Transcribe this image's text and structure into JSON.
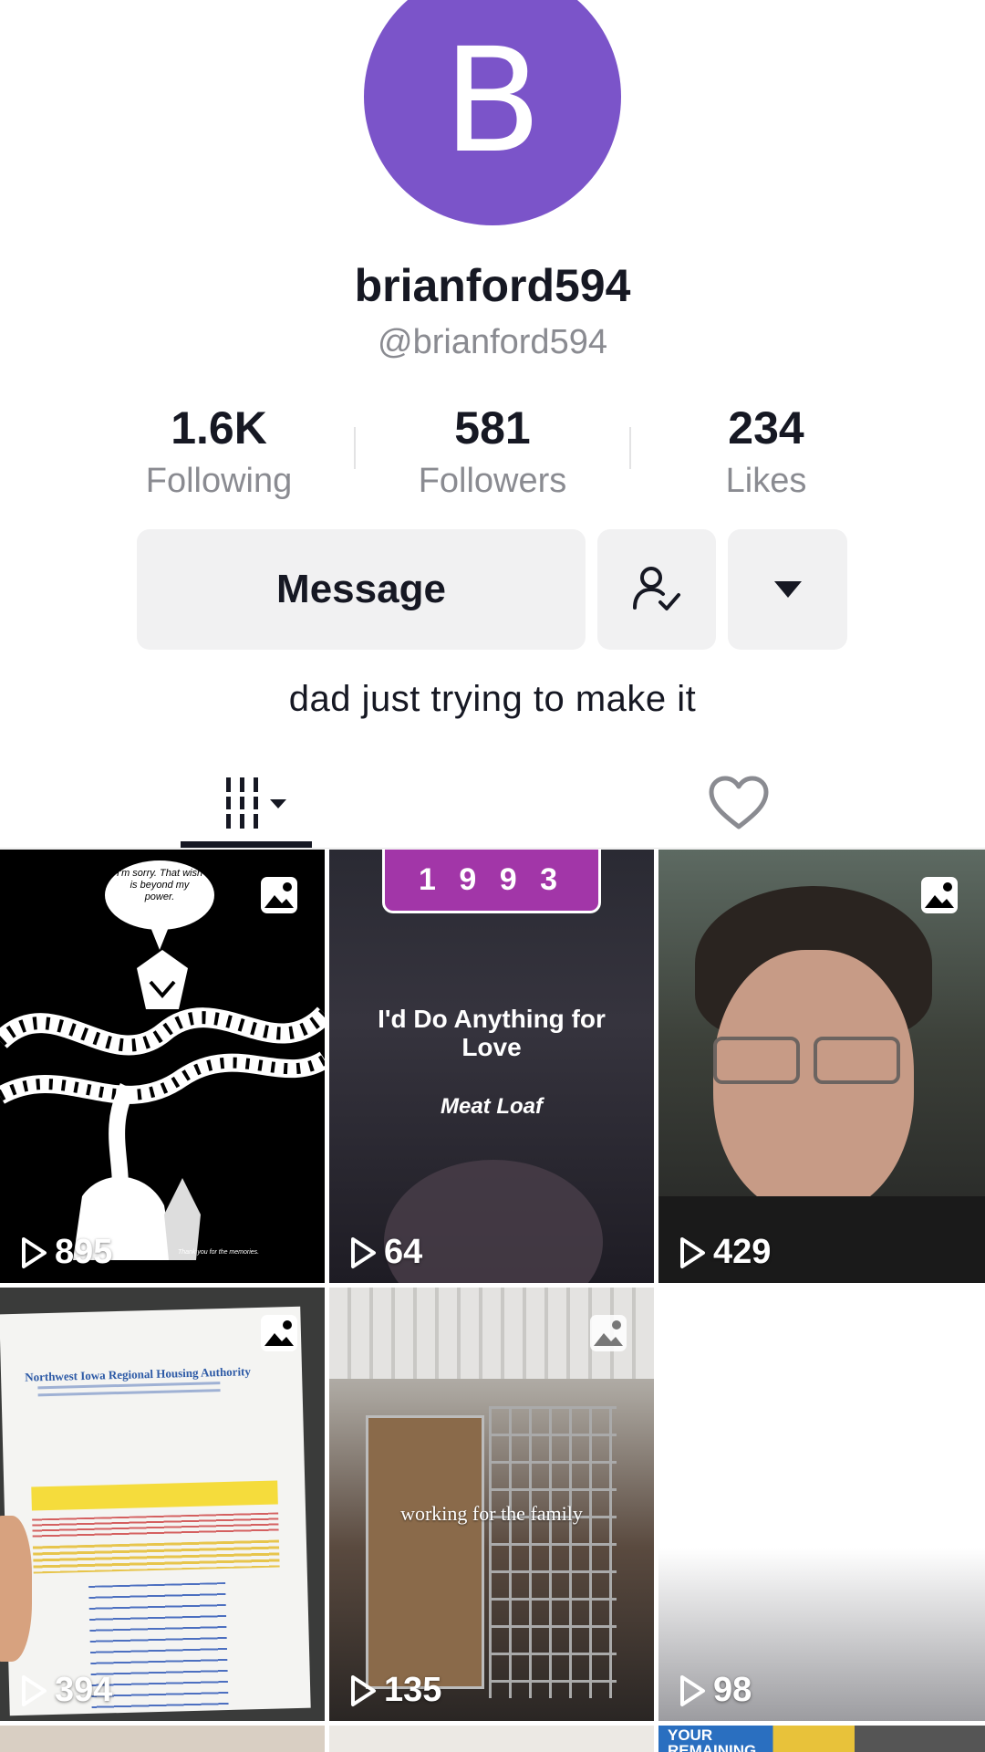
{
  "profile": {
    "avatar_letter": "B",
    "avatar_color": "#7b54c9",
    "display_name": "brianford594",
    "handle": "@brianford594",
    "bio": "dad just trying to make it"
  },
  "stats": [
    {
      "value": "1.6K",
      "label": "Following"
    },
    {
      "value": "581",
      "label": "Followers"
    },
    {
      "value": "234",
      "label": "Likes"
    }
  ],
  "actions": {
    "message_label": "Message",
    "follow_icon": "user-check-icon",
    "more_icon": "caret-down-icon"
  },
  "tabs": {
    "videos_icon": "grid-icon",
    "liked_icon": "heart-outline-icon"
  },
  "videos": [
    {
      "views": "895",
      "has_photo_badge": true,
      "overlay": {
        "speech": "I'm sorry. That wish is beyond my power.",
        "signature": "Thank you for the memories."
      }
    },
    {
      "views": "64",
      "has_photo_badge": false,
      "overlay": {
        "year": "1 9 9 3",
        "song_title": "I'd Do Anything for Love",
        "artist": "Meat Loaf"
      }
    },
    {
      "views": "429",
      "has_photo_badge": true
    },
    {
      "views": "394",
      "has_photo_badge": true,
      "overlay": {
        "doc_title": "Northwest Iowa Regional Housing Authority"
      }
    },
    {
      "views": "135",
      "has_photo_badge": true,
      "overlay": {
        "caption": "working for the family"
      }
    },
    {
      "views": "98",
      "has_photo_badge": false
    }
  ],
  "partial_row": {
    "text": "YOUR REMAINING"
  }
}
